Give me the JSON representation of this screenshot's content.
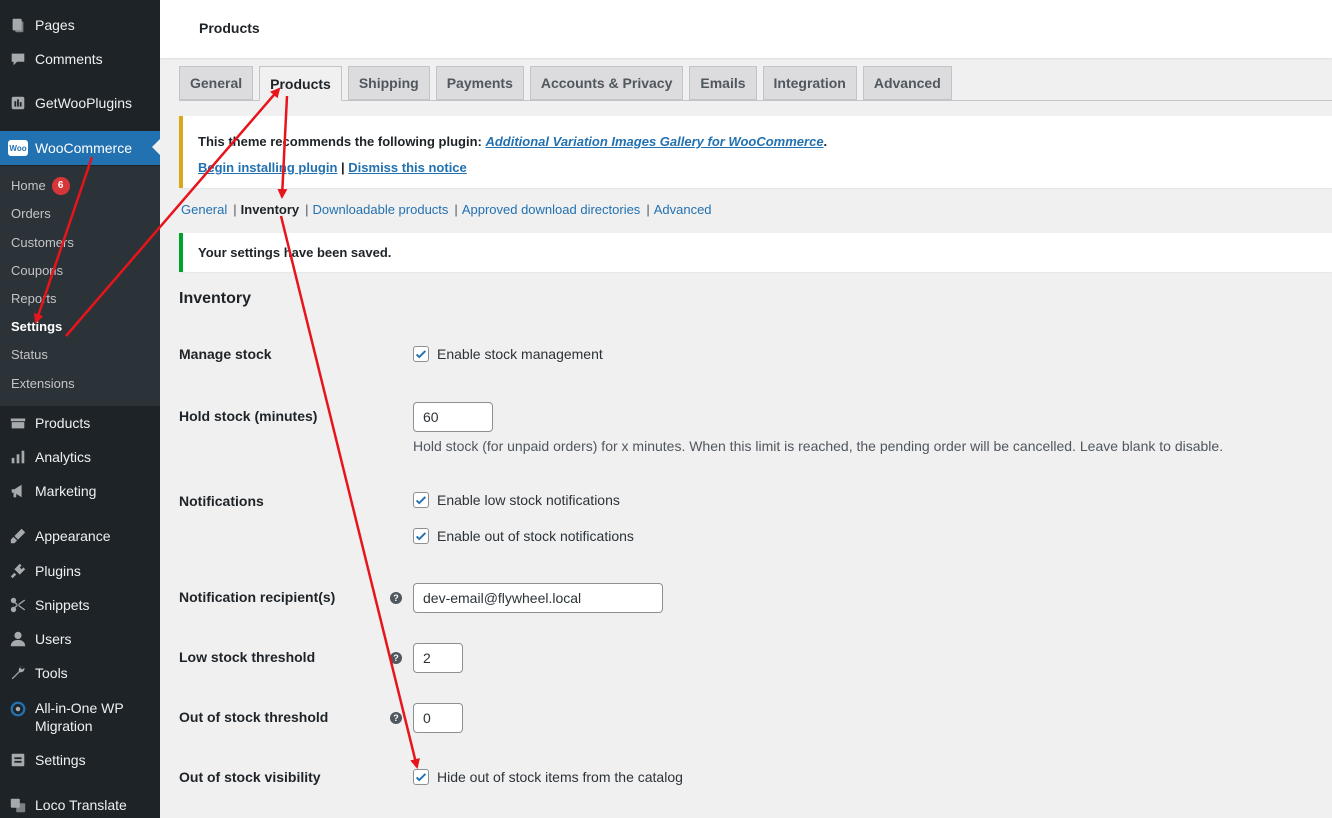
{
  "sidebar": {
    "items": [
      {
        "label": "Pages",
        "icon": "pages-icon"
      },
      {
        "label": "Comments",
        "icon": "comments-icon"
      },
      {
        "label": "GetWooPlugins",
        "icon": "getwooplugins-icon"
      },
      {
        "label": "WooCommerce",
        "icon": "woocommerce-icon"
      },
      {
        "label": "Products",
        "icon": "products-icon"
      },
      {
        "label": "Analytics",
        "icon": "analytics-icon"
      },
      {
        "label": "Marketing",
        "icon": "marketing-icon"
      },
      {
        "label": "Appearance",
        "icon": "appearance-icon"
      },
      {
        "label": "Plugins",
        "icon": "plugins-icon"
      },
      {
        "label": "Snippets",
        "icon": "snippets-icon"
      },
      {
        "label": "Users",
        "icon": "users-icon"
      },
      {
        "label": "Tools",
        "icon": "tools-icon"
      },
      {
        "label": "All-in-One WP Migration",
        "icon": "migration-icon"
      },
      {
        "label": "Settings",
        "icon": "settings-icon"
      },
      {
        "label": "Loco Translate",
        "icon": "loco-translate-icon"
      }
    ],
    "woo_badge": "Woo",
    "submenu": [
      {
        "label": "Home",
        "count": "6"
      },
      {
        "label": "Orders"
      },
      {
        "label": "Customers"
      },
      {
        "label": "Coupons"
      },
      {
        "label": "Reports"
      },
      {
        "label": "Settings"
      },
      {
        "label": "Status"
      },
      {
        "label": "Extensions"
      }
    ]
  },
  "header": {
    "title": "Products"
  },
  "tabs": [
    "General",
    "Products",
    "Shipping",
    "Payments",
    "Accounts & Privacy",
    "Emails",
    "Integration",
    "Advanced"
  ],
  "plugin_notice": {
    "prefix": "This theme recommends the following plugin: ",
    "plugin_link": "Additional Variation Images Gallery for WooCommerce",
    "suffix": ".",
    "begin_link": "Begin installing plugin",
    "separator": "|",
    "dismiss_link": "Dismiss this notice"
  },
  "subnav": [
    "General",
    "Inventory",
    "Downloadable products",
    "Approved download directories",
    "Advanced"
  ],
  "saved_notice": "Your settings have been saved.",
  "section_title": "Inventory",
  "fields": {
    "manage_stock": {
      "label": "Manage stock",
      "checkbox": "Enable stock management"
    },
    "hold_stock": {
      "label": "Hold stock (minutes)",
      "value": "60",
      "description": "Hold stock (for unpaid orders) for x minutes. When this limit is reached, the pending order will be cancelled. Leave blank to disable."
    },
    "notifications": {
      "label": "Notifications",
      "checkbox_low": "Enable low stock notifications",
      "checkbox_out": "Enable out of stock notifications"
    },
    "recipient": {
      "label": "Notification recipient(s)",
      "value": "dev-email@flywheel.local"
    },
    "low_threshold": {
      "label": "Low stock threshold",
      "value": "2"
    },
    "out_threshold": {
      "label": "Out of stock threshold",
      "value": "0"
    },
    "visibility": {
      "label": "Out of stock visibility",
      "checkbox": "Hide out of stock items from the catalog"
    }
  },
  "help_tip_glyph": "?",
  "colors": {
    "accent": "#2271b1",
    "sidebar": "#1d2327",
    "annotation": "#e8141b",
    "success": "#00a32a",
    "warning": "#dba617"
  }
}
